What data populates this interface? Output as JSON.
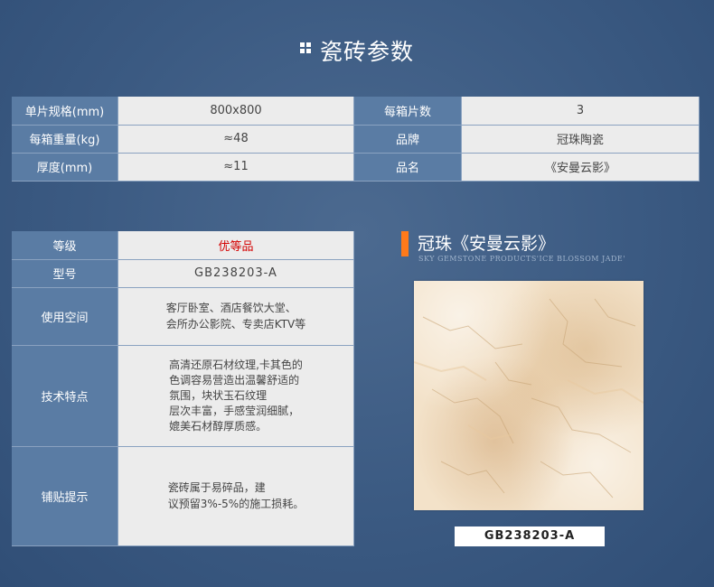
{
  "header": {
    "title": "瓷砖参数"
  },
  "specs": {
    "rows": [
      {
        "label1": "单片规格(mm)",
        "value1": "800x800",
        "label2": "每箱片数",
        "value2": "3"
      },
      {
        "label1": "每箱重量(kg)",
        "value1": "≈48",
        "label2": "品牌",
        "value2": "冠珠陶瓷"
      },
      {
        "label1": "厚度(mm)",
        "value1": "≈11",
        "label2": "品名",
        "value2": "《安曼云影》"
      }
    ]
  },
  "details": {
    "grade_label": "等级",
    "grade_value": "优等品",
    "model_label": "型号",
    "model_value": "GB238203-A",
    "space_label": "使用空间",
    "space_lines": [
      "客厅卧室、酒店餐饮大堂、",
      "会所办公影院、专卖店KTV等"
    ],
    "tech_label": "技术特点",
    "tech_lines": [
      "高清还原石材纹理,卡其色的",
      "色调容易营造出温馨舒适的",
      "氛围，块状玉石纹理",
      "层次丰富，手感莹润细腻，",
      "媲美石材醇厚质感。"
    ],
    "tips_label": "铺贴提示",
    "tips_lines": [
      "瓷砖属于易碎品，建",
      "议预留3%-5%的施工损耗。"
    ]
  },
  "product": {
    "brand_title": "冠珠《安曼云影》",
    "brand_subtitle": "SKY GEMSTONE PRODUCTS'ICE BLOSSOM JADE'",
    "code": "GB238203-A",
    "accent_color": "#ff7a1a"
  }
}
